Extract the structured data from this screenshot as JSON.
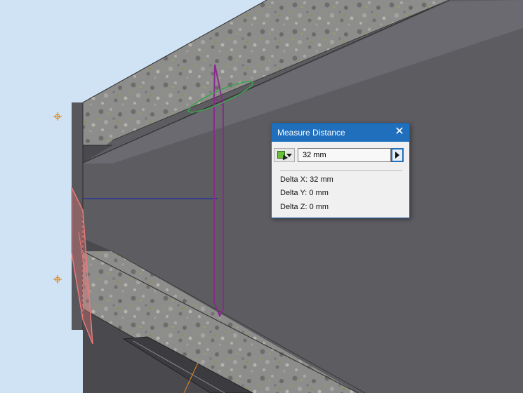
{
  "dialog": {
    "title": "Measure Distance",
    "close_icon": "close-icon",
    "selection_tool_icon": "select-cube-icon",
    "dropdown_icon": "chevron-down-icon",
    "value": "32 mm",
    "expand_icon": "play-arrow-icon",
    "results": {
      "delta_x": "Delta X: 32 mm",
      "delta_y": "Delta Y: 0 mm",
      "delta_z": "Delta Z: 0 mm"
    }
  },
  "colors": {
    "background": "#cfe3f5",
    "model_face": "#5d5c61",
    "titlebar": "#1f6fbd",
    "sketch_magenta": "#8a2a8c",
    "work_plane": "#e87a7a",
    "axis_line": "#1e2c9e",
    "point_marker": "#e58a1e",
    "circle_green": "#3aa54a"
  }
}
